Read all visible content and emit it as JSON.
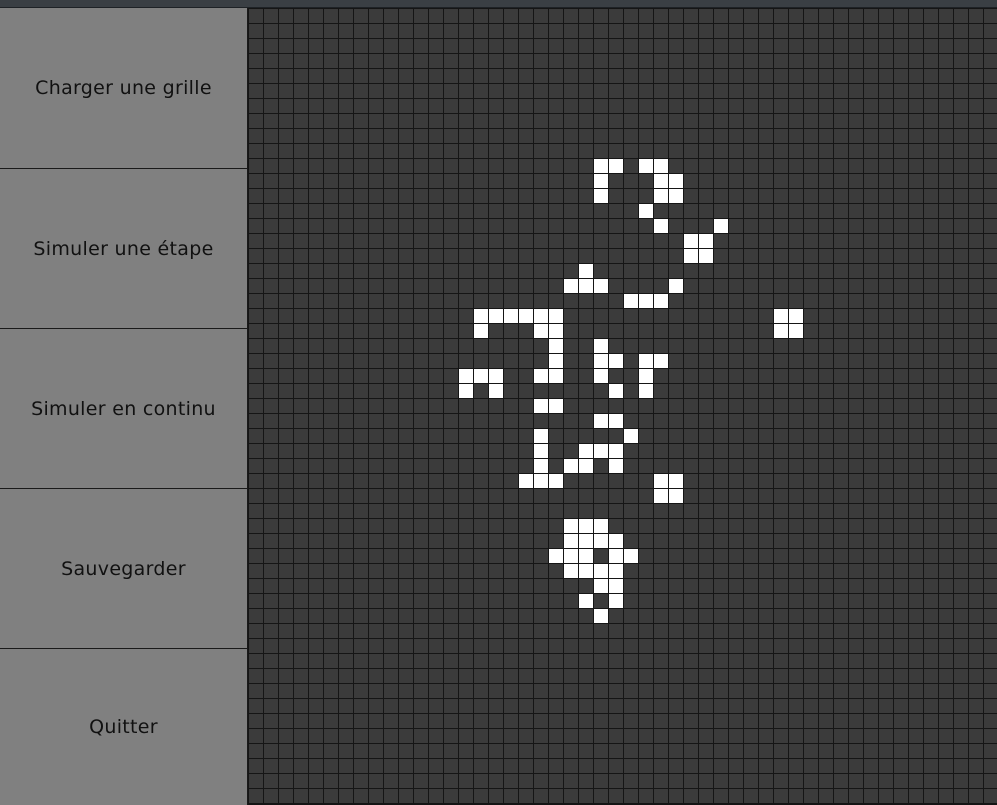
{
  "window": {
    "title": ""
  },
  "sidebar": {
    "buttons": [
      {
        "id": "load",
        "label": "Charger une grille"
      },
      {
        "id": "step",
        "label": "Simuler une étape"
      },
      {
        "id": "continuous",
        "label": "Simuler en continu"
      },
      {
        "id": "save",
        "label": "Sauvegarder"
      },
      {
        "id": "quit",
        "label": "Quitter"
      }
    ]
  },
  "grid": {
    "columns": 50,
    "rows": 53,
    "colors": {
      "dead": "#3b3b3b",
      "alive": "#ffffff",
      "lines": "#151515"
    },
    "alive_cells": [
      [
        23,
        10
      ],
      [
        24,
        10
      ],
      [
        26,
        10
      ],
      [
        27,
        10
      ],
      [
        23,
        11
      ],
      [
        27,
        11
      ],
      [
        28,
        11
      ],
      [
        23,
        12
      ],
      [
        27,
        12
      ],
      [
        28,
        12
      ],
      [
        26,
        13
      ],
      [
        27,
        14
      ],
      [
        31,
        14
      ],
      [
        29,
        15
      ],
      [
        30,
        15
      ],
      [
        29,
        16
      ],
      [
        30,
        16
      ],
      [
        22,
        17
      ],
      [
        21,
        18
      ],
      [
        22,
        18
      ],
      [
        23,
        18
      ],
      [
        28,
        18
      ],
      [
        25,
        19
      ],
      [
        26,
        19
      ],
      [
        27,
        19
      ],
      [
        15,
        20
      ],
      [
        16,
        20
      ],
      [
        17,
        20
      ],
      [
        18,
        20
      ],
      [
        19,
        20
      ],
      [
        20,
        20
      ],
      [
        35,
        20
      ],
      [
        36,
        20
      ],
      [
        15,
        21
      ],
      [
        19,
        21
      ],
      [
        20,
        21
      ],
      [
        35,
        21
      ],
      [
        36,
        21
      ],
      [
        20,
        22
      ],
      [
        23,
        22
      ],
      [
        20,
        23
      ],
      [
        23,
        23
      ],
      [
        24,
        23
      ],
      [
        26,
        23
      ],
      [
        27,
        23
      ],
      [
        14,
        24
      ],
      [
        15,
        24
      ],
      [
        16,
        24
      ],
      [
        19,
        24
      ],
      [
        20,
        24
      ],
      [
        23,
        24
      ],
      [
        26,
        24
      ],
      [
        14,
        25
      ],
      [
        16,
        25
      ],
      [
        24,
        25
      ],
      [
        26,
        25
      ],
      [
        19,
        26
      ],
      [
        20,
        26
      ],
      [
        23,
        27
      ],
      [
        24,
        27
      ],
      [
        19,
        28
      ],
      [
        25,
        28
      ],
      [
        19,
        29
      ],
      [
        22,
        29
      ],
      [
        23,
        29
      ],
      [
        24,
        29
      ],
      [
        19,
        30
      ],
      [
        21,
        30
      ],
      [
        22,
        30
      ],
      [
        24,
        30
      ],
      [
        18,
        31
      ],
      [
        19,
        31
      ],
      [
        20,
        31
      ],
      [
        27,
        31
      ],
      [
        28,
        31
      ],
      [
        27,
        32
      ],
      [
        28,
        32
      ],
      [
        21,
        34
      ],
      [
        22,
        34
      ],
      [
        23,
        34
      ],
      [
        21,
        35
      ],
      [
        22,
        35
      ],
      [
        23,
        35
      ],
      [
        24,
        35
      ],
      [
        20,
        36
      ],
      [
        21,
        36
      ],
      [
        22,
        36
      ],
      [
        24,
        36
      ],
      [
        25,
        36
      ],
      [
        21,
        37
      ],
      [
        22,
        37
      ],
      [
        23,
        37
      ],
      [
        24,
        37
      ],
      [
        23,
        38
      ],
      [
        24,
        38
      ],
      [
        22,
        39
      ],
      [
        24,
        39
      ],
      [
        23,
        40
      ]
    ]
  }
}
